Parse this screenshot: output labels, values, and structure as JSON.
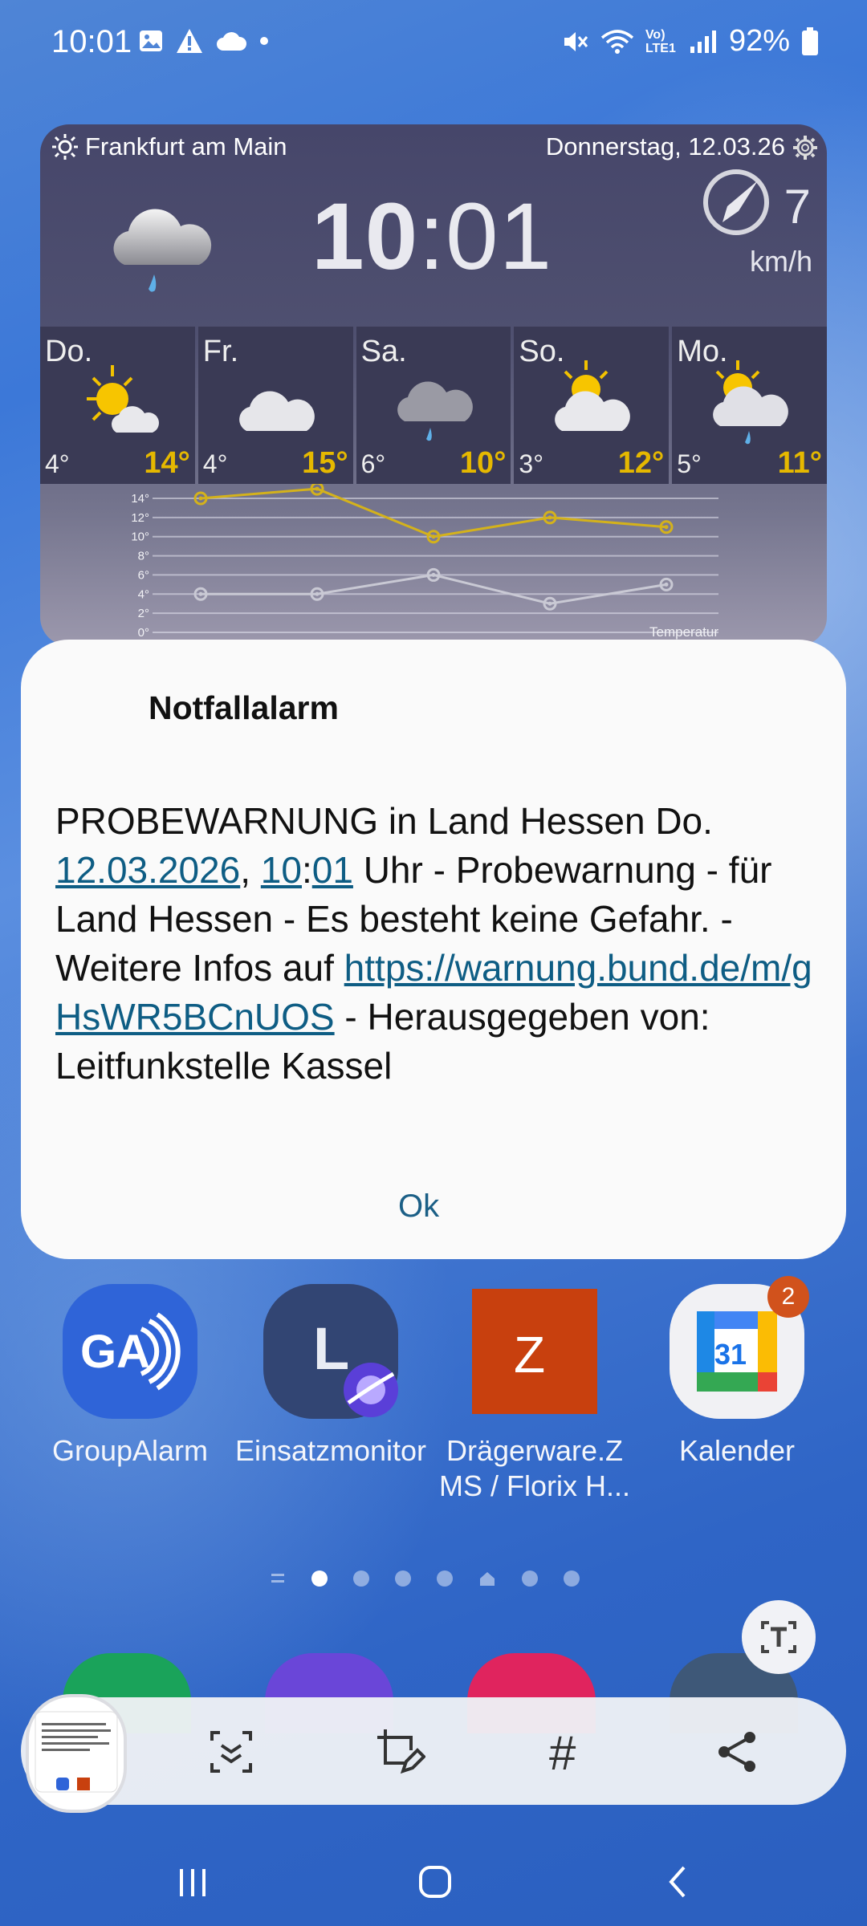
{
  "status_bar": {
    "time": "10:01",
    "battery_percent": "92%",
    "network_label": "Vo) LTE1"
  },
  "weather_widget": {
    "location": "Frankfurt am Main",
    "date": "Donnerstag, 12.03.26",
    "clock_hours": "10",
    "clock_minutes": ":01",
    "wind_speed": "7",
    "wind_unit": "km/h",
    "days": [
      {
        "name": "Do.",
        "min": "4°",
        "max": "14°",
        "icon": "sun-cloud-icon"
      },
      {
        "name": "Fr.",
        "min": "4°",
        "max": "15°",
        "icon": "cloud-icon"
      },
      {
        "name": "Sa.",
        "min": "6°",
        "max": "10°",
        "icon": "rain-cloud-icon"
      },
      {
        "name": "So.",
        "min": "3°",
        "max": "12°",
        "icon": "sun-cloud-icon"
      },
      {
        "name": "Mo.",
        "min": "5°",
        "max": "11°",
        "icon": "sun-rain-icon"
      }
    ],
    "graph": {
      "y_ticks": [
        "14°",
        "12°",
        "10°",
        "8°",
        "6°",
        "4°",
        "2°",
        "0°"
      ],
      "max_temps": [
        14,
        15,
        10,
        12,
        11
      ],
      "min_temps": [
        4,
        4,
        6,
        3,
        5
      ],
      "label": "Temperatur",
      "max_color": "#d4b21b",
      "min_color": "#c9c9d4"
    }
  },
  "dialog": {
    "title": "Notfallalarm",
    "body_1": "PROBEWARNUNG in Land Hessen Do.",
    "date_link": "12.03.2026",
    "comma": ", ",
    "time_link_h": "10",
    "time_colon": ":",
    "time_link_m": "01",
    "body_2": " Uhr - Probewarnung - für Land Hessen - Es besteht keine Gefahr. - Weitere Infos auf ",
    "url_link": "https://warnung.bund.de/m/gHsWR5BCnUOS",
    "body_3": " - Herausgegeben von: Leitfunkstelle Kassel",
    "ok_label": "Ok"
  },
  "apps": [
    {
      "label": "GroupAlarm",
      "icon": "groupalarm-icon",
      "color": "#2f64d8"
    },
    {
      "label": "Einsatzmonitor",
      "icon": "einsatzmonitor-icon",
      "color": "#324573"
    },
    {
      "label": "Drägerware.Z MS / Florix H...",
      "icon": "draegerware-icon",
      "color": "#c8400e"
    },
    {
      "label": "Kalender",
      "icon": "calendar-icon",
      "color": "#f1f1f4",
      "badge": "2",
      "calendar_day": "31"
    }
  ],
  "toolbar": {
    "items": [
      "smart-select-icon",
      "crop-edit-icon",
      "hashtag-icon",
      "share-icon"
    ],
    "hashtag_symbol": "#"
  },
  "navbar": {
    "items": [
      "recents-icon",
      "home-icon",
      "back-icon"
    ]
  }
}
